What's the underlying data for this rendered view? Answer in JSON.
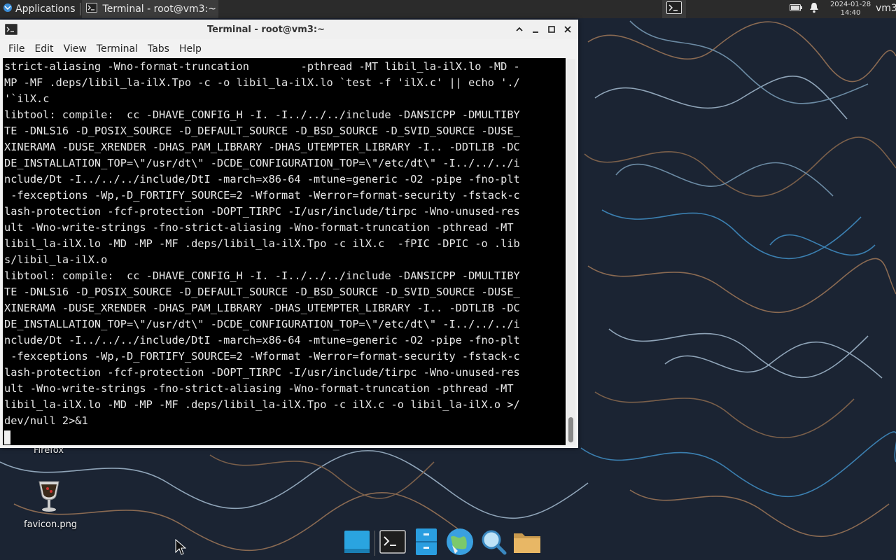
{
  "top_panel": {
    "applications_label": "Applications",
    "task_title": "Terminal - root@vm3:~",
    "clock_date": "2024-01-28",
    "clock_time": "14:40",
    "user_label": "vm3"
  },
  "window": {
    "title": "Terminal - root@vm3:~",
    "menu": [
      "File",
      "Edit",
      "View",
      "Terminal",
      "Tabs",
      "Help"
    ]
  },
  "terminal": {
    "lines": [
      "strict-aliasing -Wno-format-truncation        -pthread -MT libil_la-ilX.lo -MD -",
      "MP -MF .deps/libil_la-ilX.Tpo -c -o libil_la-ilX.lo `test -f 'ilX.c' || echo './",
      "'`ilX.c",
      "libtool: compile:  cc -DHAVE_CONFIG_H -I. -I../../../include -DANSICPP -DMULTIBY",
      "TE -DNLS16 -D_POSIX_SOURCE -D_DEFAULT_SOURCE -D_BSD_SOURCE -D_SVID_SOURCE -DUSE_",
      "XINERAMA -DUSE_XRENDER -DHAS_PAM_LIBRARY -DHAS_UTEMPTER_LIBRARY -I.. -DDTLIB -DC",
      "DE_INSTALLATION_TOP=\\\"/usr/dt\\\" -DCDE_CONFIGURATION_TOP=\\\"/etc/dt\\\" -I../../../i",
      "nclude/Dt -I../../../include/DtI -march=x86-64 -mtune=generic -O2 -pipe -fno-plt",
      " -fexceptions -Wp,-D_FORTIFY_SOURCE=2 -Wformat -Werror=format-security -fstack-c",
      "lash-protection -fcf-protection -DOPT_TIRPC -I/usr/include/tirpc -Wno-unused-res",
      "ult -Wno-write-strings -fno-strict-aliasing -Wno-format-truncation -pthread -MT",
      "libil_la-ilX.lo -MD -MP -MF .deps/libil_la-ilX.Tpo -c ilX.c  -fPIC -DPIC -o .lib",
      "s/libil_la-ilX.o",
      "libtool: compile:  cc -DHAVE_CONFIG_H -I. -I../../../include -DANSICPP -DMULTIBY",
      "TE -DNLS16 -D_POSIX_SOURCE -D_DEFAULT_SOURCE -D_BSD_SOURCE -D_SVID_SOURCE -DUSE_",
      "XINERAMA -DUSE_XRENDER -DHAS_PAM_LIBRARY -DHAS_UTEMPTER_LIBRARY -I.. -DDTLIB -DC",
      "DE_INSTALLATION_TOP=\\\"/usr/dt\\\" -DCDE_CONFIGURATION_TOP=\\\"/etc/dt\\\" -I../../../i",
      "nclude/Dt -I../../../include/DtI -march=x86-64 -mtune=generic -O2 -pipe -fno-plt",
      " -fexceptions -Wp,-D_FORTIFY_SOURCE=2 -Wformat -Werror=format-security -fstack-c",
      "lash-protection -fcf-protection -DOPT_TIRPC -I/usr/include/tirpc -Wno-unused-res",
      "ult -Wno-write-strings -fno-strict-aliasing -Wno-format-truncation -pthread -MT",
      "libil_la-ilX.lo -MD -MP -MF .deps/libil_la-ilX.Tpo -c ilX.c -o libil_la-ilX.o >/",
      "dev/null 2>&1"
    ]
  },
  "desktop": {
    "icons": [
      {
        "label": "Firefox"
      },
      {
        "label": "favicon.png"
      }
    ]
  },
  "dock": {
    "items": [
      "show-desktop",
      "terminal",
      "file-manager-blue",
      "web-browser",
      "app-finder",
      "home-folder"
    ]
  },
  "colors": {
    "panel_bg": "#2b2b2b",
    "terminal_bg": "#000000",
    "terminal_fg": "#e8e8e8",
    "wallpaper_bg": "#1b2433"
  }
}
